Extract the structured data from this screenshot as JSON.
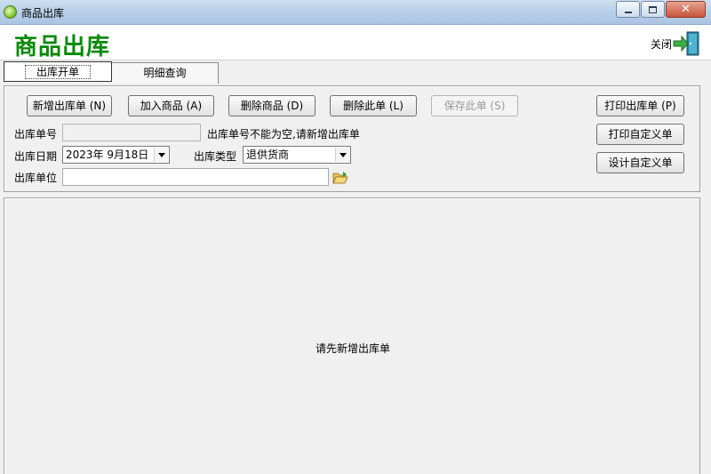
{
  "window": {
    "title": "商品出库",
    "minimize_label": "",
    "maximize_label": "",
    "close_glyph": "✕"
  },
  "header": {
    "page_title": "商品出库",
    "close_label": "关闭",
    "accent_color": "#0a8a0a"
  },
  "tabs": [
    {
      "label": "出库开单",
      "active": true
    },
    {
      "label": "明细查询",
      "active": false
    }
  ],
  "toolbar": {
    "new_order": "新增出库单 (N)",
    "add_product": "加入商品 (A)",
    "delete_product": "删除商品 (D)",
    "delete_order": "删除此单 (L)",
    "save_order": "保存此单 (S)",
    "print_order": "打印出库单 (P)",
    "print_custom": "打印自定义单",
    "design_custom": "设计自定义单"
  },
  "form": {
    "order_no_label": "出库单号",
    "order_no_value": "",
    "order_no_hint": "出库单号不能为空,请新增出库单",
    "date_label": "出库日期",
    "date_value": "2023年  9月18日",
    "type_label": "出库类型",
    "type_value": "退供货商",
    "unit_label": "出库单位",
    "unit_value": ""
  },
  "content": {
    "empty_message": "请先新增出库单"
  },
  "icons": {
    "app": "app-icon",
    "exit": "exit-door-icon",
    "folder": "folder-open-icon"
  }
}
